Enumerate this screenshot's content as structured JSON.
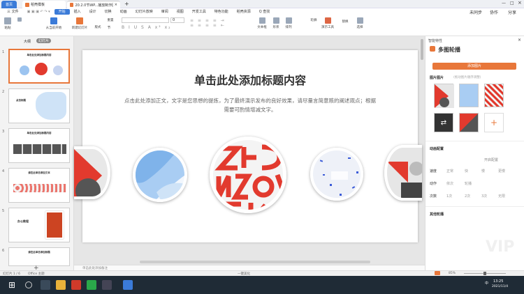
{
  "titlebar": {
    "home_tab": "首页",
    "tab1": "稻壳模板",
    "tab2": "20.2.0节WP...播放制作图文说明",
    "add_tab": "+"
  },
  "menubar": {
    "file": "三 文件",
    "items": [
      "开始",
      "插入",
      "设计",
      "切换",
      "动画",
      "幻灯片放映",
      "审阅",
      "视图",
      "开发工具",
      "特色功能",
      "稻壳资源"
    ],
    "search": "Q 查找",
    "sync": "未同步",
    "collab": "协作",
    "share": "分享"
  },
  "toolbar": {
    "paste": "粘贴",
    "from_current": "从当前开始",
    "new_slide": "新建幻灯片",
    "layout": "版式",
    "reset": "重置",
    "section": "节",
    "font_size": "0",
    "textbox": "文本框",
    "shape": "形状",
    "arrange": "排列",
    "outline": "轮廓",
    "present_tool": "演示工具",
    "replace": "替换",
    "select": "选择"
  },
  "left_panel": {
    "tab_outline": "大纲",
    "tab_slides": "幻灯片",
    "slides": [
      {
        "num": "1",
        "title": "单击此处添加标题内容"
      },
      {
        "num": "2",
        "title": "点击标题"
      },
      {
        "num": "3",
        "title": "单击此处添加标题内容"
      },
      {
        "num": "4",
        "title": "请在此单击添加文本"
      },
      {
        "num": "5",
        "title": "办公教程"
      },
      {
        "num": "6",
        "title": "请在此单击添加标题"
      }
    ],
    "add": "+"
  },
  "slide": {
    "title": "单击此处添加标题内容",
    "body": "点击此处添加正文，文字是您思想的提炼，为了最终演示发布的良好效果，请尽量言简意赅的阐述观点；根据需要可酌情增减文字。"
  },
  "notes": {
    "placeholder": "单击此处添加备注"
  },
  "right_panel": {
    "header": "智能特性",
    "title": "多图轮播",
    "add_button": "添加图片",
    "section_images": "图片图片",
    "images_hint": "(拖动图片顺序调整)",
    "section_anim": "动画配置",
    "auto_play": "开启配置",
    "speed_label": "速度",
    "speed_opts": [
      "正常",
      "快",
      "慢",
      "更慢"
    ],
    "order_label": "动作",
    "order_opts": [
      "依次",
      "轮播"
    ],
    "count_label": "次数",
    "count_opts": [
      "1次",
      "2次",
      "3次",
      "无限"
    ],
    "section_other": "其他轮播",
    "vip": "VIP"
  },
  "statusbar": {
    "slide_info": "幻灯片 1 / 6",
    "theme": "Office 主题",
    "beautify": "一键美化",
    "zoom": "85%"
  },
  "taskbar": {
    "time": "13:25",
    "date": "2021/11/4",
    "lang": "中"
  },
  "colors": {
    "accent": "#3b7bd8",
    "wps_orange": "#e8773a",
    "red_pattern": "#e23a2e"
  }
}
